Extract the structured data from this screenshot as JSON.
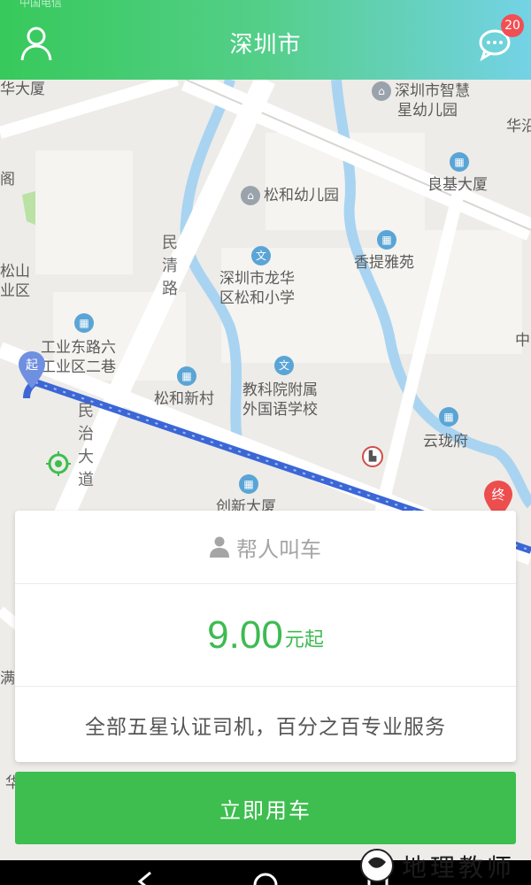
{
  "status_bar": {
    "text": "中国电信"
  },
  "header": {
    "title": "深圳市",
    "message_count": "20"
  },
  "map": {
    "roads": [
      "民清路",
      "民治大道"
    ],
    "pois": [
      "华大厦",
      "深圳市智慧",
      "星幼儿园",
      "华沿",
      "阁",
      "良基大厦",
      "松和幼儿园",
      "松山",
      "业区",
      "香提雅苑",
      "深圳市龙华",
      "区松和小学",
      "中",
      "工业东路六",
      "工业区二巷",
      "松和新村",
      "教科院附属",
      "外国语学校",
      "云珑府",
      "创新大厦",
      "满",
      "华"
    ],
    "start_label": "起",
    "end_label": "终",
    "route_color": "#3b67d6"
  },
  "booking": {
    "help_call_label": "帮人叫车",
    "price_value": "9.00",
    "price_unit": "元起",
    "description": "全部五星认证司机，百分之百专业服务",
    "cta_label": "立即用车"
  },
  "colors": {
    "brand_green": "#3dbe4f",
    "badge_red": "#f14f53"
  },
  "watermark": {
    "text": "地理教师"
  }
}
